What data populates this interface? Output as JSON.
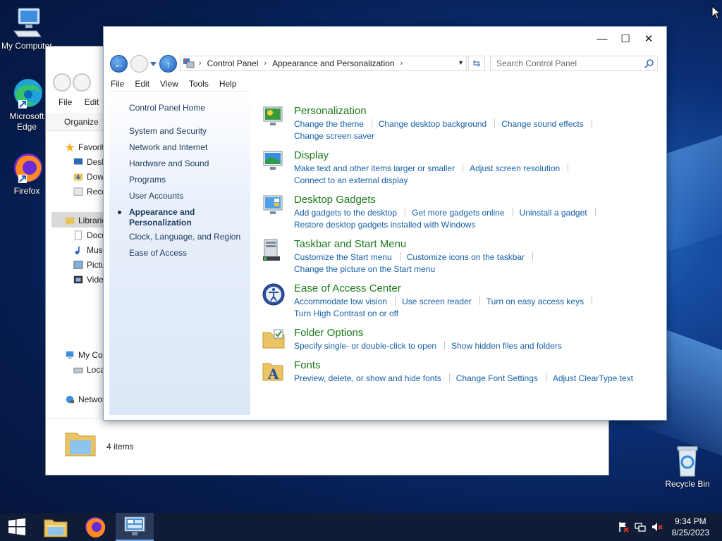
{
  "desktop": {
    "icons": [
      {
        "label": "My Computer",
        "icon": "computer-icon"
      },
      {
        "label": "Microsoft Edge",
        "icon": "edge-icon"
      },
      {
        "label": "Firefox",
        "icon": "firefox-icon"
      },
      {
        "label": "Recycle Bin",
        "icon": "recycle-bin-icon"
      }
    ]
  },
  "explorer": {
    "menu": [
      "File",
      "Edit"
    ],
    "organize": "Organize",
    "tree": [
      {
        "label": "Favorites",
        "icon": "star-icon"
      },
      {
        "label": "Desktop",
        "icon": "desktop-icon"
      },
      {
        "label": "Downloads",
        "icon": "downloads-icon"
      },
      {
        "label": "Recent Places",
        "icon": "recent-icon"
      },
      {
        "label": "Libraries",
        "icon": "library-icon"
      },
      {
        "label": "Documents",
        "icon": "documents-icon"
      },
      {
        "label": "Music",
        "icon": "music-icon"
      },
      {
        "label": "Pictures",
        "icon": "pictures-icon"
      },
      {
        "label": "Videos",
        "icon": "videos-icon"
      },
      {
        "label": "My Computer",
        "icon": "computer-icon"
      },
      {
        "label": "Local Disk",
        "icon": "disk-icon"
      },
      {
        "label": "Network",
        "icon": "network-icon"
      }
    ],
    "status": "4 items"
  },
  "control_panel": {
    "window_controls": {
      "minimize": "—",
      "maximize": "☐",
      "close": "✕"
    },
    "breadcrumbs": [
      "Control Panel",
      "Appearance and Personalization"
    ],
    "search_placeholder": "Search Control Panel",
    "menu": [
      "File",
      "Edit",
      "View",
      "Tools",
      "Help"
    ],
    "left_nav": {
      "home": "Control Panel Home",
      "items": [
        "System and Security",
        "Network and Internet",
        "Hardware and Sound",
        "Programs",
        "User Accounts",
        "Appearance and Personalization",
        "Clock, Language, and Region",
        "Ease of Access"
      ],
      "active": "Appearance and Personalization"
    },
    "categories": [
      {
        "title": "Personalization",
        "icon": "personalization-icon",
        "links": [
          "Change the theme",
          "Change desktop background",
          "Change sound effects",
          "Change screen saver"
        ]
      },
      {
        "title": "Display",
        "icon": "display-icon",
        "links": [
          "Make text and other items larger or smaller",
          "Adjust screen resolution",
          "Connect to an external display"
        ]
      },
      {
        "title": "Desktop Gadgets",
        "icon": "gadgets-icon",
        "links": [
          "Add gadgets to the desktop",
          "Get more gadgets online",
          "Uninstall a gadget",
          "Restore desktop gadgets installed with Windows"
        ]
      },
      {
        "title": "Taskbar and Start Menu",
        "icon": "taskbar-icon",
        "links": [
          "Customize the Start menu",
          "Customize icons on the taskbar",
          "Change the picture on the Start menu"
        ]
      },
      {
        "title": "Ease of Access Center",
        "icon": "ease-of-access-icon",
        "links": [
          "Accommodate low vision",
          "Use screen reader",
          "Turn on easy access keys",
          "Turn High Contrast on or off"
        ]
      },
      {
        "title": "Folder Options",
        "icon": "folder-options-icon",
        "links": [
          "Specify single- or double-click to open",
          "Show hidden files and folders"
        ]
      },
      {
        "title": "Fonts",
        "icon": "fonts-icon",
        "links": [
          "Preview, delete, or show and hide fonts",
          "Change Font Settings",
          "Adjust ClearType text"
        ]
      }
    ]
  },
  "taskbar": {
    "apps": [
      "file-explorer-icon",
      "firefox-icon",
      "control-panel-icon"
    ],
    "clock_time": "9:34 PM",
    "clock_date": "8/25/2023"
  },
  "colors": {
    "link": "#1660a8",
    "category_title": "#1c7a1c",
    "taskbar": "#101c36"
  }
}
